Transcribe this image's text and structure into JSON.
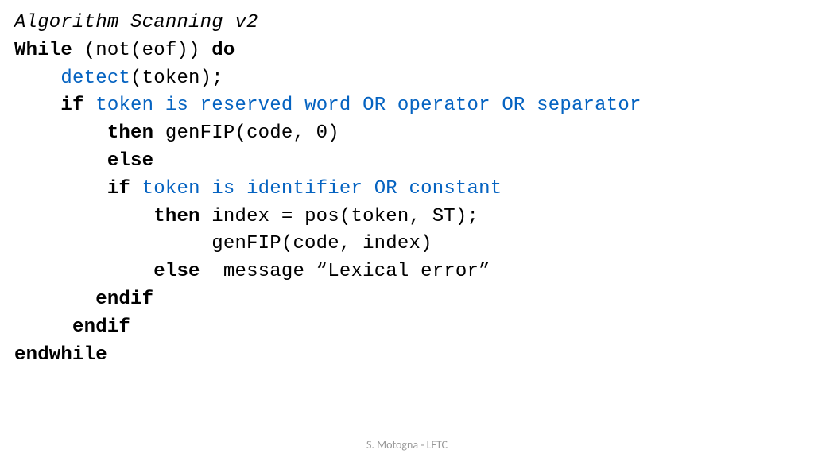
{
  "title": "Algorithm Scanning v2",
  "l1a": "While",
  "l1b": " (not(eof)) ",
  "l1c": "do",
  "l2a": "    ",
  "l2b": "detect",
  "l2c": "(token);",
  "l3a": "    ",
  "l3b": "if",
  "l3c": " ",
  "l3d": "token is reserved word OR operator OR separator",
  "l4a": "        ",
  "l4b": "then",
  "l4c": " genFIP(code, 0)",
  "l5a": "        ",
  "l5b": "else",
  "l6a": "        ",
  "l6b": "if",
  "l6c": " ",
  "l6d": "token is identifier OR constant",
  "l7a": "            ",
  "l7b": "then",
  "l7c": " index = pos(token, ST);",
  "l8a": "                 genFIP(code, index)",
  "l9a": "            ",
  "l9b": "else",
  "l9c": "  message “Lexical error”",
  "l10a": "       ",
  "l10b": "endif",
  "l11a": "     ",
  "l11b": "endif",
  "l12a": "endwhile",
  "footer": "S. Motogna - LFTC"
}
